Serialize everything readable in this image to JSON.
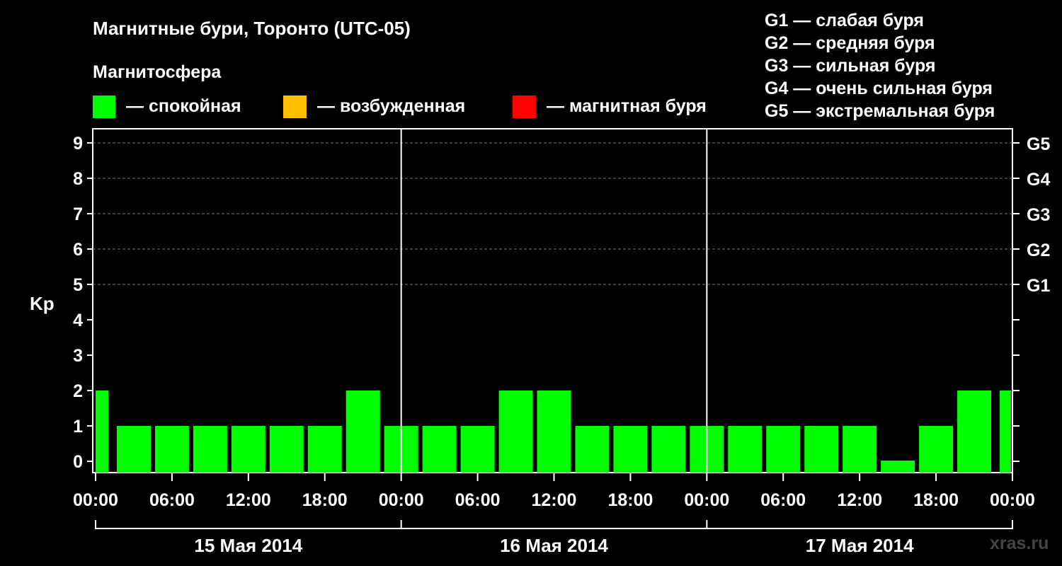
{
  "title": "Магнитные бури, Торонто (UTC-05)",
  "magnetosphere_label": "Магнитосфера",
  "states": [
    {
      "label": "— спокойная",
      "color": "#00ff00"
    },
    {
      "label": "— возбужденная",
      "color": "#ffbf00"
    },
    {
      "label": "— магнитная буря",
      "color": "#ff0000"
    }
  ],
  "g_legend": [
    "G1 — слабая буря",
    "G2 — средняя буря",
    "G3 — сильная буря",
    "G4 — очень сильная буря",
    "G5 — экстремальная буря"
  ],
  "watermark": "xras.ru",
  "chart_data": {
    "type": "bar",
    "ylabel": "Kp",
    "ylim": [
      0,
      9
    ],
    "y_ticks": [
      "0",
      "1",
      "2",
      "3",
      "4",
      "5",
      "6",
      "7",
      "8",
      "9"
    ],
    "g_levels": [
      {
        "kp": 5,
        "label": "G1"
      },
      {
        "kp": 6,
        "label": "G2"
      },
      {
        "kp": 7,
        "label": "G3"
      },
      {
        "kp": 8,
        "label": "G4"
      },
      {
        "kp": 9,
        "label": "G5"
      }
    ],
    "x_ticks": [
      "00:00",
      "06:00",
      "12:00",
      "18:00",
      "00:00",
      "06:00",
      "12:00",
      "18:00",
      "00:00",
      "06:00",
      "12:00",
      "18:00",
      "00:00"
    ],
    "days": [
      "15 Мая 2014",
      "16 Мая 2014",
      "17 Мая 2014"
    ],
    "bar_color": "#00ff00",
    "series": [
      {
        "x_hours": [
          0.5,
          3,
          6,
          9,
          12,
          15,
          18,
          21,
          24,
          27,
          30,
          33,
          36,
          39,
          42,
          45,
          48,
          51,
          54,
          57,
          60,
          63,
          66,
          69,
          71.5
        ],
        "values": [
          2,
          1,
          1,
          1,
          1,
          1,
          1,
          2,
          1,
          1,
          1,
          2,
          2,
          1,
          1,
          1,
          1,
          1,
          1,
          1,
          1,
          0,
          1,
          2,
          2
        ]
      }
    ]
  }
}
